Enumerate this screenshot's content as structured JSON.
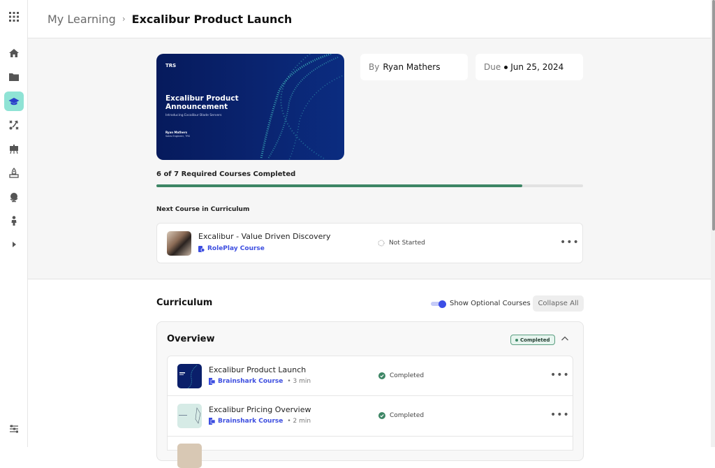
{
  "breadcrumb": {
    "parent": "My Learning",
    "separator": "›",
    "current": "Excalibur Product Launch"
  },
  "sidebar": {
    "items": [
      {
        "icon": "apps-grid-icon"
      },
      {
        "icon": "home-icon"
      },
      {
        "icon": "folder-icon"
      },
      {
        "icon": "graduation-cap-icon",
        "active": true
      },
      {
        "icon": "strategy-icon"
      },
      {
        "icon": "presentation-icon"
      },
      {
        "icon": "rocket-icon"
      },
      {
        "icon": "globe-icon"
      },
      {
        "icon": "person-icon"
      },
      {
        "icon": "expand-icon"
      },
      {
        "icon": "settings-sliders-icon"
      }
    ]
  },
  "hero": {
    "logo": "TRS",
    "title": "Excalibur Product Announcement",
    "subtitle": "Introducing Excalibur Blade Servers",
    "author": "Ryan Mathers",
    "role": "Sales Engineer, TRS"
  },
  "info": {
    "by_label": "By",
    "by_value": "Ryan Mathers",
    "due_label": "Due",
    "due_value": "Jun 25, 2024"
  },
  "progress": {
    "label": "6 of 7 Required Courses Completed",
    "completed": 6,
    "total": 7,
    "color": "#3d8665"
  },
  "next_course": {
    "heading": "Next Course in Curriculum",
    "title": "Excalibur - Value Driven Discovery",
    "type": "RolePlay Course",
    "status": "Not Started",
    "more": "•••"
  },
  "curriculum": {
    "title": "Curriculum",
    "toggle_label": "Show Optional Courses",
    "toggle_on": true,
    "collapse_label": "Collapse All",
    "sections": [
      {
        "title": "Overview",
        "badge": "Completed",
        "courses": [
          {
            "title": "Excalibur Product Launch",
            "type": "Brainshark Course",
            "duration": "3 min",
            "status": "Completed",
            "more": "•••"
          },
          {
            "title": "Excalibur Pricing Overview",
            "type": "Brainshark Course",
            "duration": "2 min",
            "status": "Completed",
            "more": "•••"
          }
        ]
      }
    ]
  },
  "colors": {
    "accent": "#3c4ee6",
    "active_nav": "#8fe3d5",
    "success": "#3d8665"
  }
}
